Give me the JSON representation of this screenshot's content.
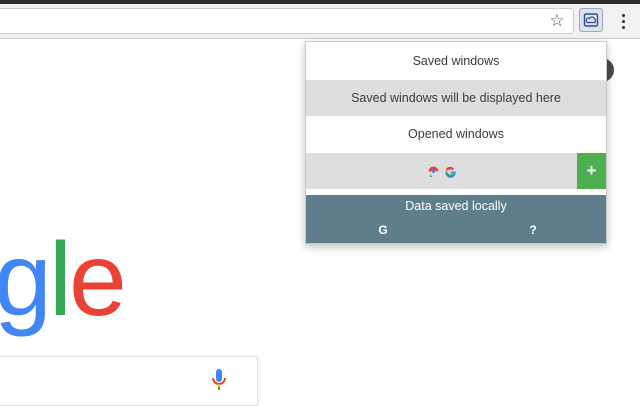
{
  "browser": {
    "bookmark_icon": "star-icon",
    "extension_icon": "cloud-window-icon",
    "menu_icon": "three-dot-menu-icon"
  },
  "page": {
    "logo_fragment": {
      "g": "g",
      "l": "l",
      "e": "e"
    },
    "mic_icon": "microphone-icon"
  },
  "popup": {
    "saved_section_title": "Saved windows",
    "saved_empty_message": "Saved windows will be displayed here",
    "opened_section_title": "Opened windows",
    "opened_window": {
      "favicons": [
        "chrome-web-store-icon",
        "google-g-icon"
      ],
      "add_label": "+"
    },
    "footer": {
      "status": "Data saved locally",
      "google_label": "G",
      "help_label": "?"
    }
  },
  "colors": {
    "footer_bg": "#607d8b",
    "add_button_bg": "#4caf50",
    "row_gray": "#dedede"
  }
}
